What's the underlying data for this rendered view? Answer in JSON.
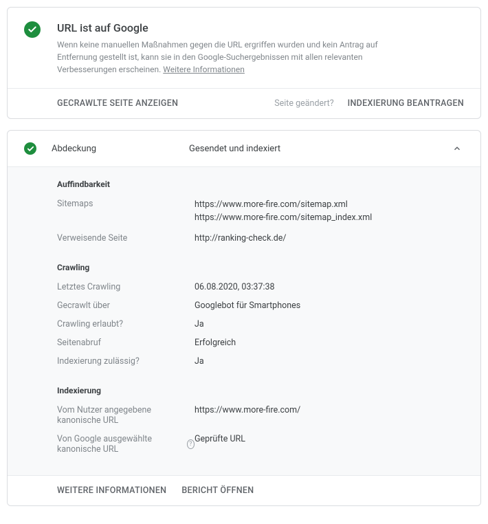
{
  "header": {
    "title": "URL ist auf Google",
    "description": "Wenn keine manuellen Maßnahmen gegen die URL ergriffen wurden und kein Antrag auf Entfernung gestellt ist, kann sie in den Google-Suchergebnissen mit allen relevanten Verbesserungen erscheinen. ",
    "more_info": "Weitere Informationen"
  },
  "actions": {
    "view_crawled": "GECRAWLTE SEITE ANZEIGEN",
    "page_changed": "Seite geändert?",
    "request_indexing": "INDEXIERUNG BEANTRAGEN"
  },
  "coverage": {
    "label": "Abdeckung",
    "status": "Gesendet und indexiert",
    "sections": {
      "discovery": {
        "title": "Auffindbarkeit",
        "sitemaps_label": "Sitemaps",
        "sitemaps_value1": "https://www.more-fire.com/sitemap.xml",
        "sitemaps_value2": "https://www.more-fire.com/sitemap_index.xml",
        "referrer_label": "Verweisende Seite",
        "referrer_value": "http://ranking-check.de/"
      },
      "crawling": {
        "title": "Crawling",
        "last_crawl_label": "Letztes Crawling",
        "last_crawl_value": "06.08.2020, 03:37:38",
        "crawled_as_label": "Gecrawlt über",
        "crawled_as_value": "Googlebot für Smartphones",
        "crawl_allowed_label": "Crawling erlaubt?",
        "crawl_allowed_value": "Ja",
        "page_fetch_label": "Seitenabruf",
        "page_fetch_value": "Erfolgreich",
        "indexing_allowed_label": "Indexierung zulässig?",
        "indexing_allowed_value": "Ja"
      },
      "indexing": {
        "title": "Indexierung",
        "user_canonical_label": "Vom Nutzer angegebene kanonische URL",
        "user_canonical_value": "https://www.more-fire.com/",
        "google_canonical_label": "Von Google ausgewählte kanonische URL",
        "google_canonical_value": "Geprüfte URL"
      }
    },
    "footer": {
      "more_info": "WEITERE INFORMATIONEN",
      "open_report": "BERICHT ÖFFNEN"
    }
  }
}
